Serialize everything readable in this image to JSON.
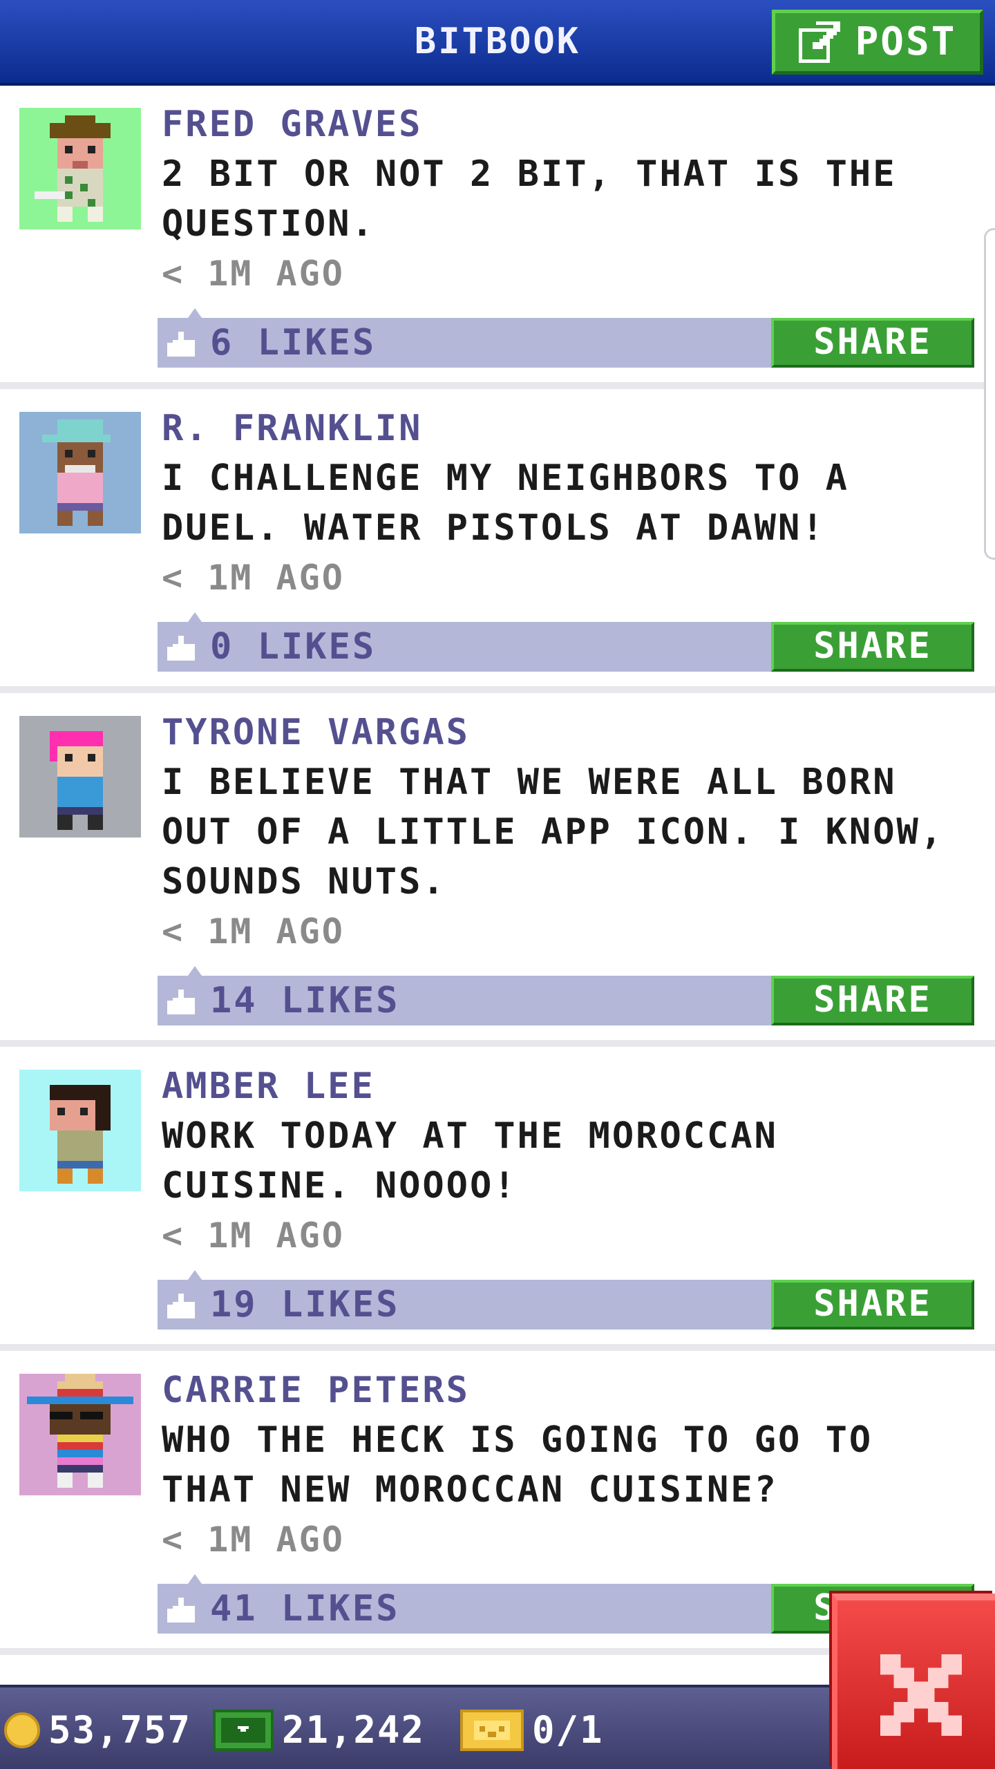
{
  "header": {
    "title": "BITBOOK",
    "post_button_label": "POST"
  },
  "posts": [
    {
      "author": "FRED GRAVES",
      "text": "2 BIT OR NOT 2 BIT, THAT IS THE QUESTION.",
      "time": "< 1M AGO",
      "likes": "6 LIKES",
      "share_label": "SHARE",
      "avatar_bg": "#8ef596"
    },
    {
      "author": "R. FRANKLIN",
      "text": "I CHALLENGE MY NEIGHBORS TO A DUEL. WATER PISTOLS AT DAWN!",
      "time": "< 1M AGO",
      "likes": "0 LIKES",
      "share_label": "SHARE",
      "avatar_bg": "#8db2d6"
    },
    {
      "author": "TYRONE VARGAS",
      "text": "I BELIEVE THAT WE WERE ALL BORN OUT OF A LITTLE APP ICON. I KNOW, SOUNDS NUTS.",
      "time": "< 1M AGO",
      "likes": "14 LIKES",
      "share_label": "SHARE",
      "avatar_bg": "#a9abb2"
    },
    {
      "author": "AMBER LEE",
      "text": "WORK TODAY AT THE MOROCCAN CUISINE. NOOOO!",
      "time": "< 1M AGO",
      "likes": "19 LIKES",
      "share_label": "SHARE",
      "avatar_bg": "#aaf6f7"
    },
    {
      "author": "CARRIE PETERS",
      "text": "WHO THE HECK IS GOING TO GO TO THAT NEW MOROCCAN CUISINE?",
      "time": "< 1M AGO",
      "likes": "41 LIKES",
      "share_label": "SHARE",
      "avatar_bg": "#d9a3d1"
    }
  ],
  "footer": {
    "coins": "53,757",
    "bux": "21,242",
    "vip": "0/1"
  },
  "colors": {
    "header_blue": "#1a3ca6",
    "button_green": "#3aa036",
    "like_bar": "#b4b7d8",
    "author_purple": "#545090",
    "close_red": "#e02a2a"
  },
  "icons": {
    "post": "edit-icon",
    "like": "thumbs-up-icon",
    "coin": "coin-icon",
    "bux": "bux-icon",
    "vip": "vip-ticket-icon",
    "close": "close-icon"
  }
}
